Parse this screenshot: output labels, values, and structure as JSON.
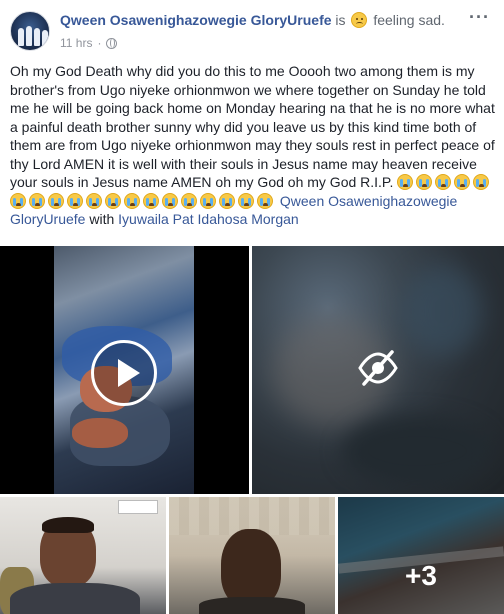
{
  "post": {
    "author": "Qween Osawenighazowegie GloryUruefe",
    "is_text": "is",
    "feeling_text": "feeling sad.",
    "feeling_icon": "sad-face-emoji",
    "time": "11 hrs",
    "dot": "·",
    "privacy_icon": "globe-icon",
    "more_label": "···",
    "body": "Oh my God Death why did you do this to me Ooooh two among them is my brother's from Ugo niyeke orhionmwon we where together on Sunday he told me he will be going back home on Monday hearing na that he is no more what a painful death brother sunny why did you leave us by this kind time both of them are from Ugo niyeke orhionmwon may they souls rest in perfect peace of thy Lord AMEN it is well with their souls in Jesus name may heaven receive your souls in Jesus name AMEN oh my God oh my God R.I.P.",
    "crying_emoji_count": 19,
    "tag_author": "Qween Osawenighazowegie GloryUruefe",
    "with_text": "with",
    "tagged_person": "Iyuwaila Pat Idahosa Morgan"
  },
  "media": {
    "extra_count": "+3"
  },
  "colors": {
    "link": "#385898",
    "text": "#1d2129",
    "muted": "#90949c"
  }
}
